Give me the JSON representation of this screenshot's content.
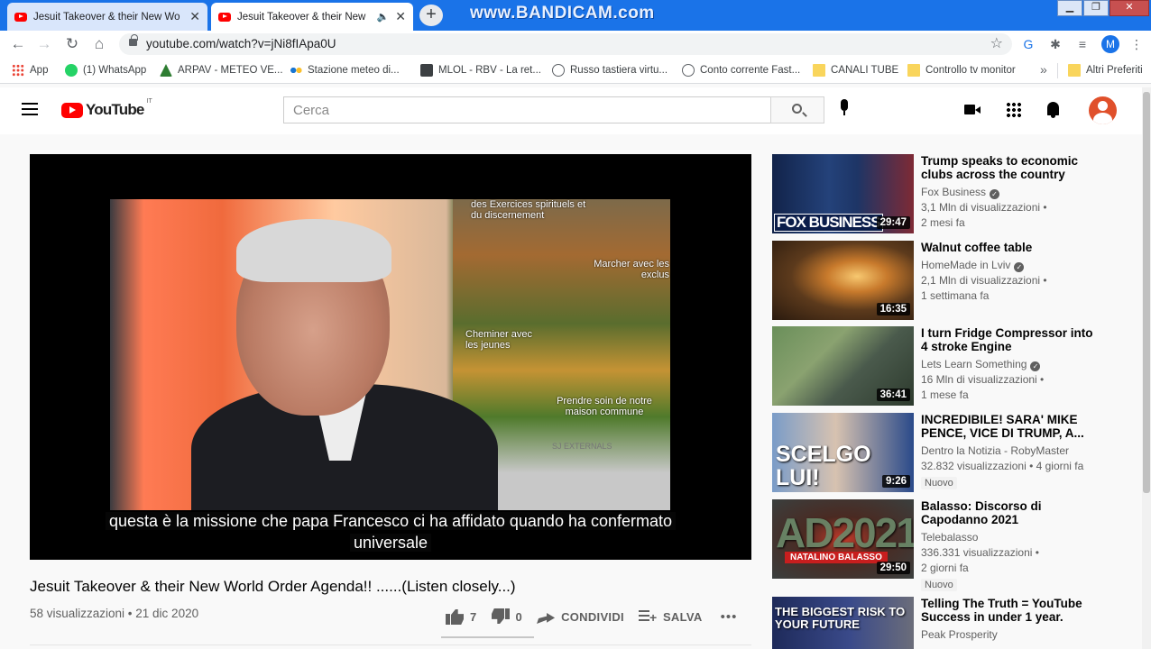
{
  "browser": {
    "tabs": [
      {
        "title": "Jesuit Takeover & their New Wo",
        "active": false
      },
      {
        "title": "Jesuit Takeover & their New",
        "active": true,
        "audio": true
      }
    ],
    "overlay_watermark": "www.BANDICAM.com",
    "url": "youtube.com/watch?v=jNi8fIApa0U",
    "profile_initial": "M",
    "bookmarks": [
      {
        "label": "App",
        "icon": "apps-grid-icon"
      },
      {
        "label": "(1) WhatsApp",
        "icon": "whatsapp-icon"
      },
      {
        "label": "ARPAV - METEO VE...",
        "icon": "arpav-icon"
      },
      {
        "label": "Stazione meteo di...",
        "icon": "meteo-dots-icon"
      },
      {
        "label": "MLOL - RBV - La ret...",
        "icon": "mlol-icon"
      },
      {
        "label": "Russo tastiera virtu...",
        "icon": "globe-icon"
      },
      {
        "label": "Conto corrente Fast...",
        "icon": "globe-icon"
      },
      {
        "label": "CANALI TUBE",
        "icon": "folder-icon"
      },
      {
        "label": "Controllo tv monitor",
        "icon": "folder-icon"
      }
    ],
    "bookmarks_more": "»",
    "other_bookmarks": "Altri Preferiti"
  },
  "youtube": {
    "logo_text": "YouTube",
    "logo_country": "IT",
    "search_placeholder": "Cerca",
    "player": {
      "subtitle_line1": "questa è la missione che papa Francesco ci ha affidato quando ha confermato",
      "subtitle_line2": "universale",
      "background_panel_texts": [
        "des Exercices spirituels et du discernement",
        "Marcher avec les exclus",
        "Cheminer avec les jeunes",
        "Prendre soin de notre maison commune",
        "SJ EXTERNALS"
      ]
    },
    "video": {
      "title": "Jesuit Takeover & their New World Order Agenda!! ......(Listen closely...)",
      "meta": "58 visualizzazioni • 21 dic 2020",
      "likes": "7",
      "dislikes": "0",
      "share_label": "CONDIVIDI",
      "save_label": "SALVA",
      "more": "•••"
    },
    "recommendations": [
      {
        "title": "Trump speaks to economic clubs across the country from...",
        "channel": "Fox Business",
        "verified": true,
        "views": "3,1 Mln di visualizzazioni •",
        "age": "2 mesi fa",
        "duration": "29:47",
        "badge": "",
        "thumb_text": "FOX BUSINESS"
      },
      {
        "title": "Walnut coffee table",
        "channel": "HomeMade in Lviv",
        "verified": true,
        "views": "2,1 Mln di visualizzazioni •",
        "age": "1 settimana fa",
        "duration": "16:35",
        "badge": "",
        "thumb_text": ""
      },
      {
        "title": "I turn Fridge Compressor into 4 stroke Engine",
        "channel": "Lets Learn Something",
        "verified": true,
        "views": "16 Mln di visualizzazioni •",
        "age": "1 mese fa",
        "duration": "36:41",
        "badge": "",
        "thumb_text": ""
      },
      {
        "title": "INCREDIBILE! SARA' MIKE PENCE, VICE DI TRUMP, A...",
        "channel": "Dentro la Notizia - RobyMaster",
        "verified": false,
        "views": "32.832 visualizzazioni • 4 giorni fa",
        "age": "",
        "duration": "9:26",
        "badge": "Nuovo",
        "thumb_text": "SCELGO LUI!"
      },
      {
        "title": "Balasso: Discorso di Capodanno 2021",
        "channel": "Telebalasso",
        "verified": false,
        "views": "336.331 visualizzazioni •",
        "age": "2 giorni fa",
        "duration": "29:50",
        "badge": "Nuovo",
        "thumb_text": "AD2021",
        "thumb_banner": "NATALINO BALASSO"
      },
      {
        "title": "Telling The Truth = YouTube Success in under 1 year.",
        "channel": "Peak Prosperity",
        "verified": false,
        "views": "",
        "age": "",
        "duration": "",
        "badge": "",
        "thumb_text": "THE BIGGEST RISK TO YOUR FUTURE"
      }
    ]
  }
}
